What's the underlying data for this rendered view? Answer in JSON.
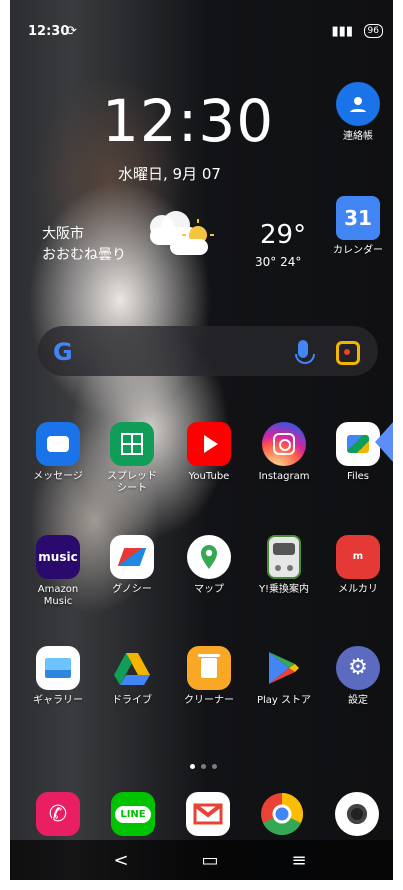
{
  "status": {
    "time": "12:30"
  },
  "clock": {
    "time": "12:30",
    "date": "水曜日, 9月 07"
  },
  "weather": {
    "city": "大阪市",
    "desc": "おおむね曇り",
    "temp": "29°",
    "range": "30°  24°"
  },
  "apps_row1": [
    {
      "label": "メッセージ"
    },
    {
      "label": "スプレッド\nシート"
    },
    {
      "label": "YouTube"
    },
    {
      "label": "Instagram"
    },
    {
      "label": "Files"
    }
  ],
  "apps_row2": [
    {
      "label": "Amazon\nMusic"
    },
    {
      "label": "グノシー"
    },
    {
      "label": "マップ"
    },
    {
      "label": "Y!乗換案内"
    },
    {
      "label": "メルカリ"
    }
  ],
  "apps_row3": [
    {
      "label": "ギャラリー"
    },
    {
      "label": "ドライブ"
    },
    {
      "label": "クリーナー"
    },
    {
      "label": "Play ストア"
    },
    {
      "label": "設定"
    }
  ],
  "right_apps": [
    {
      "label": "連絡帳"
    },
    {
      "label": "カレンダー"
    }
  ],
  "icons": {
    "calendar_day": "31",
    "amazon_music_word": "music",
    "line_word": "LINE"
  },
  "dock": [
    {
      "name": "phone"
    },
    {
      "name": "line"
    },
    {
      "name": "gmail"
    },
    {
      "name": "chrome"
    },
    {
      "name": "camera"
    }
  ],
  "nav": {
    "back": "<",
    "home": "▭",
    "menu": "≡"
  }
}
